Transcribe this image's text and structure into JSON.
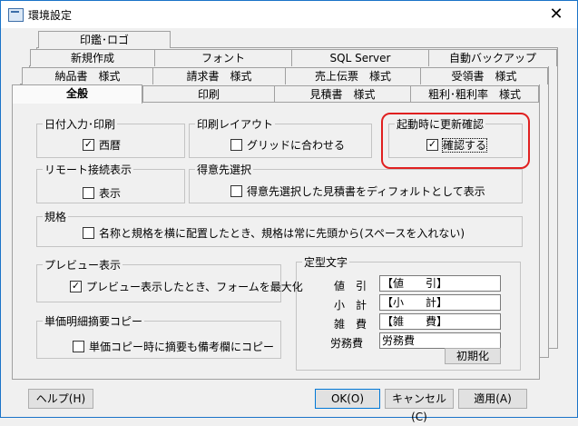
{
  "window": {
    "title": "環境設定",
    "close_label": "✕"
  },
  "tabs": {
    "row1": [
      "印鑑･ロゴ"
    ],
    "row2": [
      "新規作成",
      "フォント",
      "SQL Server",
      "自動バックアップ"
    ],
    "row3": [
      "納品書　様式",
      "請求書　様式",
      "売上伝票　様式",
      "受領書　様式"
    ],
    "row4": [
      "全般",
      "印刷",
      "見積書　様式",
      "粗利･粗利率　様式"
    ],
    "active": "全般"
  },
  "groups": {
    "date": {
      "legend": "日付入力･印刷",
      "checkbox_label": "西暦",
      "checked": true
    },
    "print_layout": {
      "legend": "印刷レイアウト",
      "checkbox_label": "グリッドに合わせる",
      "checked": false
    },
    "startup": {
      "legend": "起動時に更新確認",
      "checkbox_label": "確認する",
      "checked": true
    },
    "remote": {
      "legend": "リモート接続表示",
      "checkbox_label": "表示",
      "checked": false
    },
    "customer": {
      "legend": "得意先選択",
      "checkbox_label": "得意先選択した見積書をディフォルトとして表示",
      "checked": false
    },
    "spec": {
      "legend": "規格",
      "checkbox_label": "名称と規格を横に配置したとき、規格は常に先頭から(スペースを入れない)",
      "checked": false
    },
    "preview": {
      "legend": "プレビュー表示",
      "checkbox_label": "プレビュー表示したとき、フォームを最大化",
      "checked": true
    },
    "unit_price": {
      "legend": "単価明細摘要コピー",
      "checkbox_label": "単価コピー時に摘要も備考欄にコピー",
      "checked": false
    }
  },
  "fixed_text": {
    "legend": "定型文字",
    "rows": [
      {
        "label": "値　引",
        "value": "【値　　引】"
      },
      {
        "label": "小　計",
        "value": "【小　　計】"
      },
      {
        "label": "雑　費",
        "value": "【雑　　費】"
      },
      {
        "label": "労務費",
        "value": "労務費"
      }
    ],
    "reset_label": "初期化"
  },
  "buttons": {
    "help": "ヘルプ(H)",
    "ok": "OK(O)",
    "cancel": "キャンセル(C)",
    "apply": "適用(A)"
  },
  "colors": {
    "highlight": "#e02020",
    "focus": "#0078d7"
  }
}
